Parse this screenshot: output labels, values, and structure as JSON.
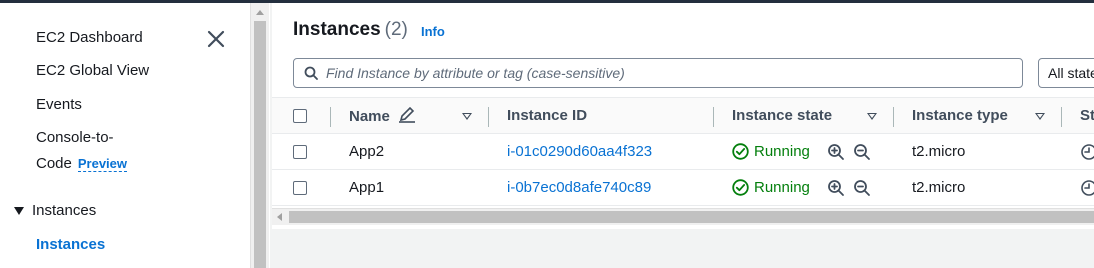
{
  "sidebar": {
    "items": [
      {
        "label": "EC2 Dashboard"
      },
      {
        "label": "EC2 Global View"
      },
      {
        "label": "Events"
      },
      {
        "label_line1": "Console-to-",
        "label_line2": "Code",
        "badge": "Preview"
      }
    ],
    "section": {
      "label": "Instances"
    },
    "active_item": {
      "label": "Instances"
    },
    "close_icon": "close-icon"
  },
  "main": {
    "title": "Instances",
    "count": "(2)",
    "info_link": "Info",
    "search": {
      "placeholder": "Find Instance by attribute or tag (case-sensitive)"
    },
    "state_filter": {
      "value": "All states"
    },
    "columns": [
      "Name",
      "Instance ID",
      "Instance state",
      "Instance type",
      "St"
    ],
    "rows": [
      {
        "name": "App2",
        "instance_id": "i-01c0290d60aa4f323",
        "state": "Running",
        "type": "t2.micro"
      },
      {
        "name": "App1",
        "instance_id": "i-0b7ec0d8afe740c89",
        "state": "Running",
        "type": "t2.micro"
      }
    ]
  },
  "colors": {
    "link": "#0972d3",
    "running": "#037f0c",
    "header_bg": "#fafafa"
  }
}
